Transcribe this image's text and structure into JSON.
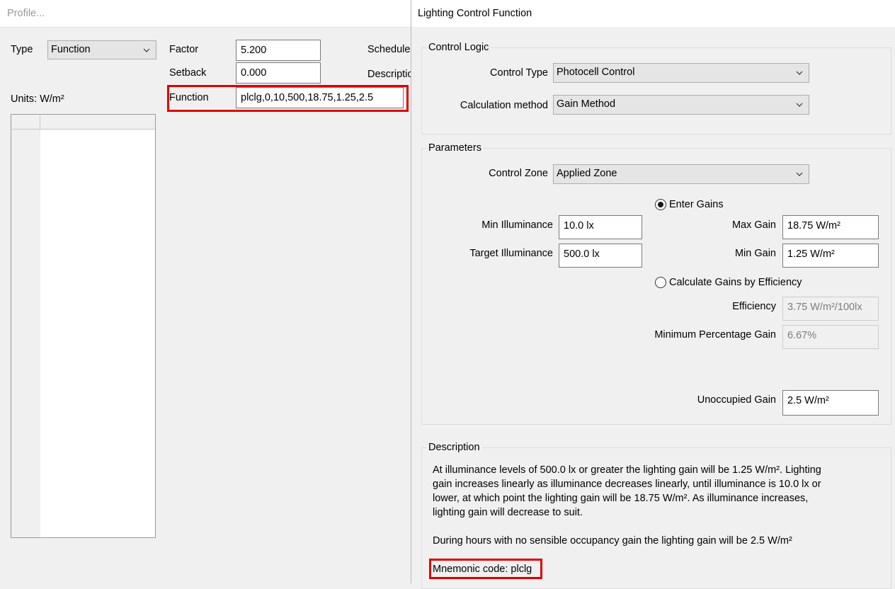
{
  "profile": {
    "title": "Profile...",
    "type_label": "Type",
    "type_value": "Function",
    "factor_label": "Factor",
    "factor_value": "5.200",
    "setback_label": "Setback",
    "setback_value": "0.000",
    "function_label": "Function",
    "function_value": "plclg,0,10,500,18.75,1.25,2.5",
    "schedule_label": "Schedule",
    "description_label": "Description",
    "units_label": "Units: W/m²"
  },
  "dialog": {
    "title": "Lighting Control Function",
    "control_logic": {
      "group_title": "Control Logic",
      "control_type_label": "Control Type",
      "control_type_value": "Photocell Control",
      "calc_method_label": "Calculation method",
      "calc_method_value": "Gain Method"
    },
    "parameters": {
      "group_title": "Parameters",
      "control_zone_label": "Control Zone",
      "control_zone_value": "Applied Zone",
      "enter_gains_label": "Enter Gains",
      "calc_gains_label": "Calculate Gains by Efficiency",
      "min_illuminance_label": "Min Illuminance",
      "min_illuminance_value": "10.0 lx",
      "target_illuminance_label": "Target Illuminance",
      "target_illuminance_value": "500.0 lx",
      "max_gain_label": "Max Gain",
      "max_gain_value": "18.75 W/m²",
      "min_gain_label": "Min Gain",
      "min_gain_value": "1.25 W/m²",
      "efficiency_label": "Efficiency",
      "efficiency_value": "3.75 W/m²/100lx",
      "min_pct_gain_label": "Minimum Percentage Gain",
      "min_pct_gain_value": "6.67%",
      "unoccupied_gain_label": "Unoccupied Gain",
      "unoccupied_gain_value": "2.5 W/m²"
    },
    "description": {
      "group_title": "Description",
      "line1": "At illuminance levels of 500.0 lx or greater the lighting gain will be 1.25 W/m². Lighting",
      "line2": "gain increases linearly as illuminance decreases linearly, until illuminance is 10.0 lx or",
      "line3": "lower, at which point the lighting gain will be 18.75 W/m². As illuminance increases,",
      "line4": "lighting gain will decrease to suit.",
      "line5": "During hours with no sensible occupancy gain the lighting gain will be 2.5 W/m²",
      "mnemonic": "Mnemonic code: plclg"
    }
  },
  "colors": {
    "highlight": "#e00000",
    "window_bg": "#f0f0f0"
  }
}
